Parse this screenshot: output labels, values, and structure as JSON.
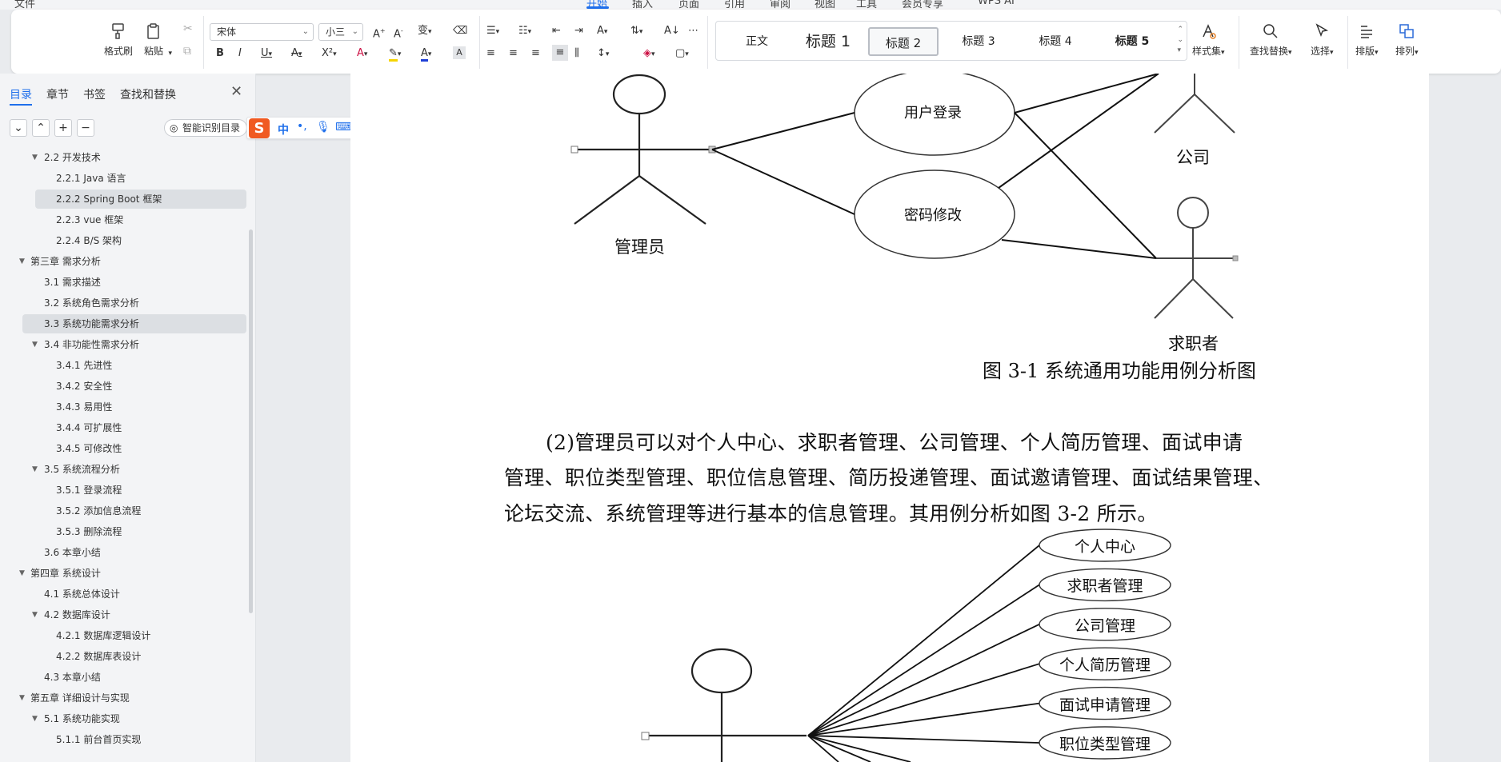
{
  "menu": {
    "items": [
      "文件",
      "开始",
      "插入",
      "页面",
      "引用",
      "审阅",
      "视图",
      "工具",
      "会员专享",
      "WPS AI"
    ],
    "active": "开始"
  },
  "ribbon": {
    "format_painter": "格式刷",
    "paste": "粘贴",
    "font_name": "宋体",
    "font_size": "小三",
    "styles": [
      "正文",
      "标题 1",
      "标题 2",
      "标题 3",
      "标题 4",
      "标题 5"
    ],
    "active_style": "标题 2",
    "style_set": "样式集",
    "find_replace": "查找替换",
    "select": "选择",
    "layout": "排版",
    "arrange": "排列"
  },
  "nav": {
    "tabs": [
      "目录",
      "章节",
      "书签",
      "查找和替换"
    ],
    "active_tab": "目录",
    "smart_toc": "智能识别目录",
    "items": [
      {
        "level": 2,
        "text": "2.2  开发技术",
        "expand": true
      },
      {
        "level": 3,
        "text": "2.2.1 Java 语言"
      },
      {
        "level": 3,
        "text": "2.2.2 Spring Boot 框架",
        "highlight": true
      },
      {
        "level": 3,
        "text": "2.2.3 vue 框架"
      },
      {
        "level": 3,
        "text": "2.2.4 B/S 架构"
      },
      {
        "level": 1,
        "text": "第三章  需求分析",
        "expand": true
      },
      {
        "level": 2,
        "text": "3.1  需求描述"
      },
      {
        "level": 2,
        "text": "3.2  系统角色需求分析"
      },
      {
        "level": 2,
        "text": "3.3  系统功能需求分析",
        "highlight": true
      },
      {
        "level": 2,
        "text": "3.4  非功能性需求分析",
        "expand": true
      },
      {
        "level": 3,
        "text": "3.4.1  先进性"
      },
      {
        "level": 3,
        "text": "3.4.2  安全性"
      },
      {
        "level": 3,
        "text": "3.4.3  易用性"
      },
      {
        "level": 3,
        "text": "3.4.4  可扩展性"
      },
      {
        "level": 3,
        "text": "3.4.5  可修改性"
      },
      {
        "level": 2,
        "text": "3.5  系统流程分析",
        "expand": true
      },
      {
        "level": 3,
        "text": "3.5.1  登录流程"
      },
      {
        "level": 3,
        "text": "3.5.2  添加信息流程"
      },
      {
        "level": 3,
        "text": "3.5.3  删除流程"
      },
      {
        "level": 2,
        "text": "3.6  本章小结"
      },
      {
        "level": 1,
        "text": "第四章  系统设计",
        "expand": true
      },
      {
        "level": 2,
        "text": "4.1  系统总体设计"
      },
      {
        "level": 2,
        "text": "4.2  数据库设计",
        "expand": true
      },
      {
        "level": 3,
        "text": "4.2.1  数据库逻辑设计"
      },
      {
        "level": 3,
        "text": "4.2.2  数据库表设计"
      },
      {
        "level": 2,
        "text": "4.3  本章小结"
      },
      {
        "level": 1,
        "text": "第五章  详细设计与实现",
        "expand": true
      },
      {
        "level": 2,
        "text": "5.1  系统功能实现",
        "expand": true
      },
      {
        "level": 3,
        "text": "5.1.1  前台首页实现"
      }
    ]
  },
  "document": {
    "diagram1": {
      "actors": [
        "管理员",
        "公司",
        "求职者"
      ],
      "usecases": [
        "用户登录",
        "密码修改"
      ]
    },
    "figure_caption": "图 3-1  系统通用功能用例分析图",
    "paragraph_lines": [
      "(2)管理员可以对个人中心、求职者管理、公司管理、个人简历管理、面试申请",
      "管理、职位类型管理、职位信息管理、简历投递管理、面试邀请管理、面试结果管理、",
      "论坛交流、系统管理等进行基本的信息管理。其用例分析如图 3-2 所示。"
    ],
    "diagram2": {
      "usecases": [
        "个人中心",
        "求职者管理",
        "公司管理",
        "个人简历管理",
        "面试申请管理",
        "职位类型管理"
      ]
    }
  }
}
